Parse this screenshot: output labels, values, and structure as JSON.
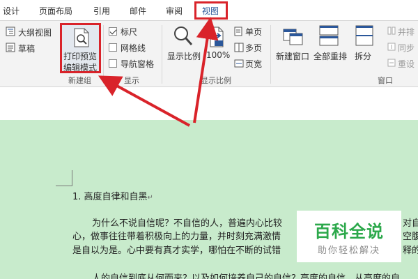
{
  "tabs": [
    {
      "label": "设计"
    },
    {
      "label": "页面布局"
    },
    {
      "label": "引用"
    },
    {
      "label": "邮件"
    },
    {
      "label": "审阅"
    },
    {
      "label": "视图"
    }
  ],
  "ribbon": {
    "views": {
      "outline_label": "大纲视图",
      "draft_label": "草稿",
      "print_preview_line1": "打印预览",
      "print_preview_line2": "编辑模式",
      "group_label": "新建组"
    },
    "show": {
      "ruler_label": "标尺",
      "gridlines_label": "网格线",
      "nav_pane_label": "导航窗格",
      "group_label": "显示"
    },
    "zoom": {
      "zoom_label": "显示比例",
      "hundred_label": "100%",
      "one_page_label": "单页",
      "multi_page_label": "多页",
      "page_width_label": "页宽",
      "group_label": "显示比例"
    },
    "window": {
      "new_window_label": "新建窗口",
      "arrange_all_label": "全部重排",
      "split_label": "拆分",
      "side_by_side_label": "并排",
      "sync_scroll_label": "同步",
      "reset_position_label": "重设",
      "group_label": "窗口"
    }
  },
  "document": {
    "heading": "1.  高度自律和自黑",
    "para_line1": "为什么不说自信呢？不自信的人，普遍内心比较",
    "para_line1_tail": "对自己",
    "para_line2": "心，做事往往带着积极向上的力量，并时刻充满激情",
    "para_line2_tail": "空腹自",
    "para_line3": "是自以为是。心中要有真才实学，哪怕在不断的试错",
    "para_line3_tail": "释的那",
    "para_line4": "人的自信到底从何而来？以及如何培养自己的自信？高度的自信，从高度的自"
  },
  "watermark": {
    "main": "百科全说",
    "sub": "助你轻松解决"
  },
  "colors": {
    "highlight_red": "#d9232a",
    "doc_green": "#c8ebcc",
    "watermark_green": "#2ba84a",
    "accent_blue": "#2b579a"
  }
}
